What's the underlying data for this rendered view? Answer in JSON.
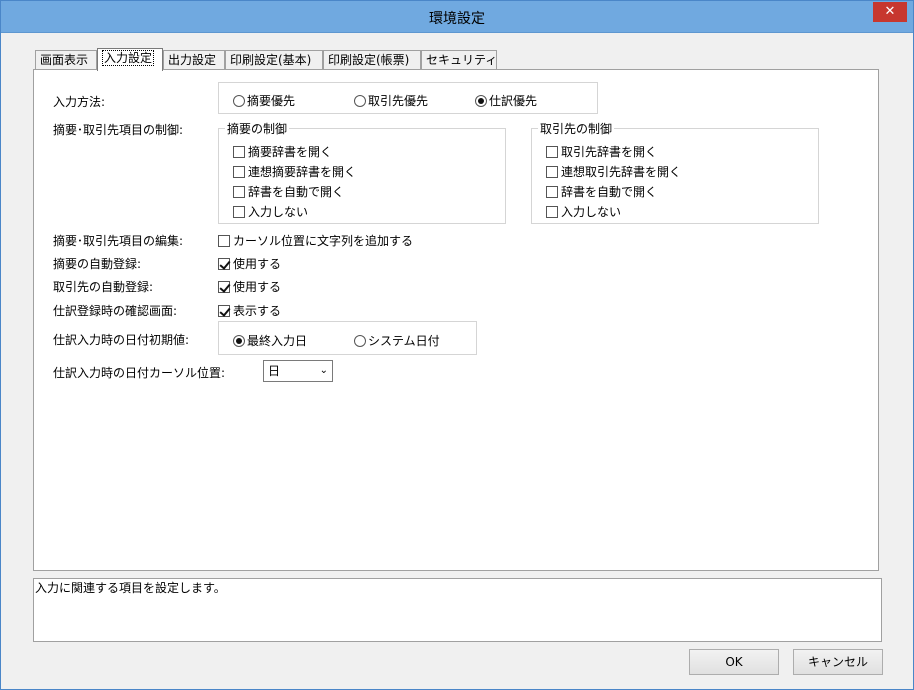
{
  "window": {
    "title": "環境設定",
    "close_glyph": "✕"
  },
  "tabs": [
    {
      "label": "画面表示"
    },
    {
      "label": "入力設定"
    },
    {
      "label": "出力設定"
    },
    {
      "label": "印刷設定(基本)"
    },
    {
      "label": "印刷設定(帳票)"
    },
    {
      "label": "セキュリティ"
    }
  ],
  "active_tab": "入力設定",
  "input_method": {
    "label": "入力方法:",
    "options": [
      "摘要優先",
      "取引先優先",
      "仕訳優先"
    ],
    "selected": "仕訳優先"
  },
  "control": {
    "label": "摘要･取引先項目の制御:",
    "summary_group": {
      "title": "摘要の制御",
      "items": [
        {
          "label": "摘要辞書を開く",
          "checked": false
        },
        {
          "label": "連想摘要辞書を開く",
          "checked": false
        },
        {
          "label": "辞書を自動で開く",
          "checked": false
        },
        {
          "label": "入力しない",
          "checked": false
        }
      ]
    },
    "partner_group": {
      "title": "取引先の制御",
      "items": [
        {
          "label": "取引先辞書を開く",
          "checked": false
        },
        {
          "label": "連想取引先辞書を開く",
          "checked": false
        },
        {
          "label": "辞書を自動で開く",
          "checked": false
        },
        {
          "label": "入力しない",
          "checked": false
        }
      ]
    }
  },
  "edit": {
    "label": "摘要･取引先項目の編集:",
    "option": "カーソル位置に文字列を追加する",
    "checked": false
  },
  "auto_summary": {
    "label": "摘要の自動登録:",
    "option": "使用する",
    "checked": true
  },
  "auto_partner": {
    "label": "取引先の自動登録:",
    "option": "使用する",
    "checked": true
  },
  "confirm": {
    "label": "仕訳登録時の確認画面:",
    "option": "表示する",
    "checked": true
  },
  "date_init": {
    "label": "仕訳入力時の日付初期値:",
    "options": [
      "最終入力日",
      "システム日付"
    ],
    "selected": "最終入力日"
  },
  "date_cursor": {
    "label": "仕訳入力時の日付カーソル位置:",
    "value": "日"
  },
  "description": "入力に関連する項目を設定します。",
  "buttons": {
    "ok": "OK",
    "cancel": "キャンセル"
  }
}
